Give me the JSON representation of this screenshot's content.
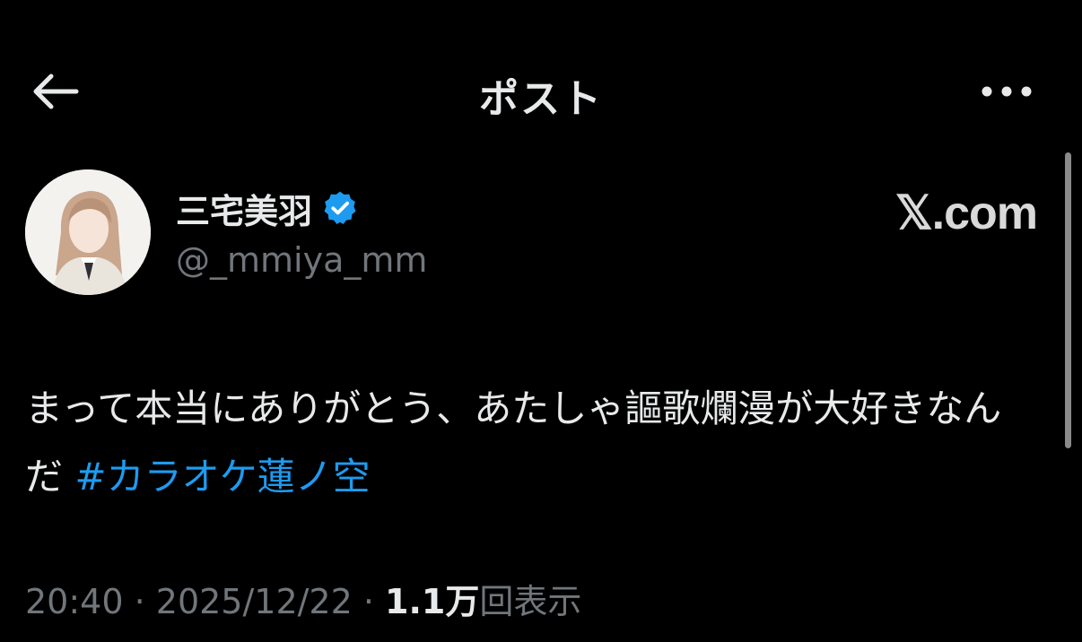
{
  "header": {
    "title": "ポスト",
    "back_icon": "arrow-left-icon",
    "more_icon": "more-horizontal-icon"
  },
  "author": {
    "name": "三宅美羽",
    "handle": "@_mmiya_mm",
    "verified_icon": "verified-badge-icon",
    "verified_color": "#1d9bf0"
  },
  "source_label": "𝕏.com",
  "tweet": {
    "text_line": "まって本当にありがとう、あたしゃ謳歌爛漫が大好きなんだ",
    "hashtag": "#カラオケ蓮ノ空"
  },
  "meta": {
    "time": "20:40",
    "sep1": " · ",
    "date": "2025/12/22",
    "sep2": " · ",
    "views_count": "1.1万",
    "views_label": "回表示"
  },
  "colors": {
    "background": "#000000",
    "text_primary": "#e7e9ea",
    "text_secondary": "#71767b",
    "link": "#1d9bf0"
  }
}
